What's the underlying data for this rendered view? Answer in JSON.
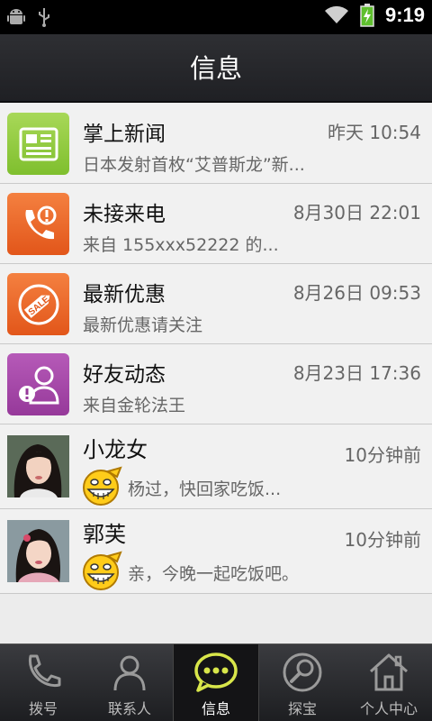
{
  "status_bar": {
    "time": "9:19",
    "icons": [
      "android-icon",
      "usb-icon",
      "wifi-icon",
      "battery-charging-icon"
    ]
  },
  "header": {
    "title": "信息"
  },
  "messages": [
    {
      "name": "掌上新闻",
      "time": "昨天 10:54",
      "preview": "日本发射首枚“艾普斯龙”新...",
      "icon": "newspaper-icon",
      "color": "#8cc63f"
    },
    {
      "name": "未接来电",
      "time": "8月30日 22:01",
      "preview": "来自 155xxx52222 的...",
      "icon": "missed-call-icon",
      "color": "#ee6a2c"
    },
    {
      "name": "最新优惠",
      "time": "8月26日 09:53",
      "preview": "最新优惠请关注",
      "icon": "sale-tag-icon",
      "color": "#ee6a2c"
    },
    {
      "name": "好友动态",
      "time": "8月23日 17:36",
      "preview": "来自金轮法王",
      "icon": "friend-alert-icon",
      "color": "#a548a8"
    },
    {
      "name": "小龙女",
      "time": "10分钟前",
      "preview": "杨过，快回家吃饭...",
      "icon": "grin-emoji-icon"
    },
    {
      "name": "郭芙",
      "time": "10分钟前",
      "preview": "亲，今晚一起吃饭吧。",
      "icon": "grin-emoji-icon"
    }
  ],
  "tabs": [
    {
      "label": "拨号",
      "icon": "phone-icon"
    },
    {
      "label": "联系人",
      "icon": "contacts-icon"
    },
    {
      "label": "信息",
      "icon": "chat-bubble-icon",
      "active": true
    },
    {
      "label": "探宝",
      "icon": "magnifier-icon"
    },
    {
      "label": "个人中心",
      "icon": "home-icon"
    }
  ]
}
